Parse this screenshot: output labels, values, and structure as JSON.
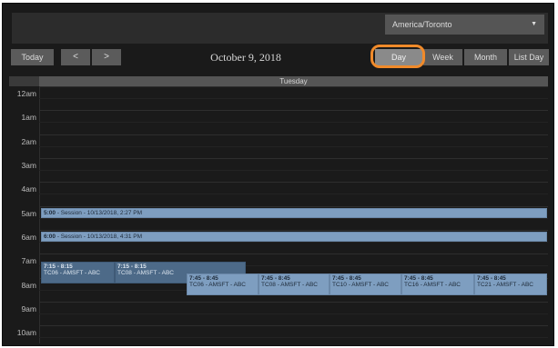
{
  "toolbar": {
    "timezone": "America/Toronto",
    "today": "Today",
    "prev": "<",
    "next": ">",
    "date": "October 9, 2018",
    "views": {
      "day": "Day",
      "week": "Week",
      "month": "Month",
      "list_day": "List Day"
    }
  },
  "day_header": "Tuesday",
  "hours": [
    "12am",
    "1am",
    "2am",
    "3am",
    "4am",
    "5am",
    "6am",
    "7am",
    "8am",
    "9am",
    "10am"
  ],
  "events": {
    "e1": {
      "time": "5:00",
      "title": "- Session - 10/13/2018, 2:27 PM"
    },
    "e2": {
      "time": "6:00",
      "title": "- Session - 10/13/2018, 4:31 PM"
    },
    "e3": {
      "time": "7:15 - 8:15",
      "title": "TC06 - AMSFT - ABC"
    },
    "e4": {
      "time": "7:15 - 8:15",
      "title": "TC08 - AMSFT - ABC"
    },
    "e5": {
      "time": "7:45 - 8:45",
      "title": "TC06 - AMSFT - ABC"
    },
    "e6": {
      "time": "7:45 - 8:45",
      "title": "TC08 - AMSFT - ABC"
    },
    "e7": {
      "time": "7:45 - 8:45",
      "title": "TC10 - AMSFT - ABC"
    },
    "e8": {
      "time": "7:45 - 8:45",
      "title": "TC16 - AMSFT - ABC"
    },
    "e9": {
      "time": "7:45 - 8:45",
      "title": "TC21 - AMSFT - ABC"
    }
  },
  "colors": {
    "highlight": "#f08a2a",
    "event": "#7e9ec0",
    "event_dark": "#4d6a88"
  }
}
